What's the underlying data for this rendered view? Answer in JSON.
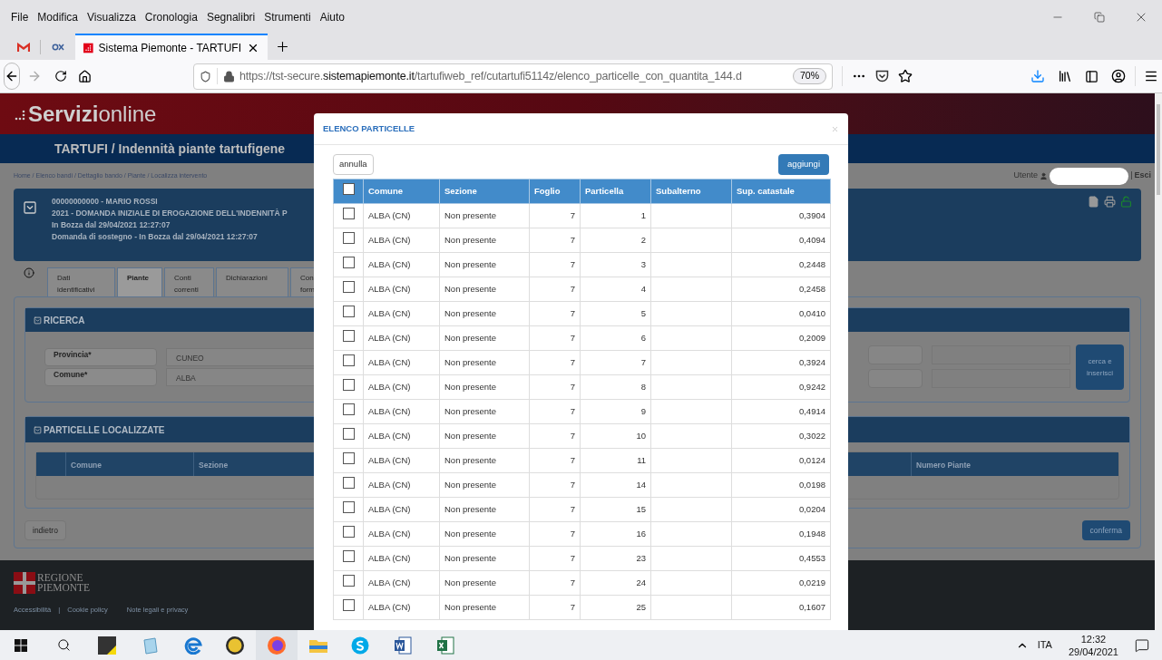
{
  "browser": {
    "menu": [
      "File",
      "Modifica",
      "Visualizza",
      "Cronologia",
      "Segnalibri",
      "Strumenti",
      "Aiuto"
    ],
    "tab": {
      "title": "Sistema Piemonte - TARTUFI",
      "selected": true
    },
    "url": {
      "prefix": "https://tst-secure.",
      "domain": "sistemapiemonte.it",
      "path": "/tartufiweb_ref/cutartufi5114z/elenco_particelle_con_quantita_144.d"
    },
    "zoom": "70%"
  },
  "page": {
    "logo": {
      "bold": "Servizi",
      "light": "online"
    },
    "title": "TARTUFI / Indennità piante tartufigene",
    "breadcrumb": "Home / Elenco bandi / Dettaglio bando / Piante / Localizza intervento",
    "user": {
      "label": "Utente",
      "separator": "|",
      "logout": "Esci"
    },
    "summary": [
      "00000000000 - MARIO ROSSI",
      "2021 - DOMANDA INIZIALE DI EROGAZIONE DELL'INDENNITÀ P",
      "In Bozza dal 29/04/2021 12:27:07",
      "Domanda di sostegno - In Bozza dal 29/04/2021 12:27:07"
    ],
    "tabs": [
      {
        "label": "Dati identificativi",
        "selected": false
      },
      {
        "label": "Piante",
        "selected": true
      },
      {
        "label": "Conti correnti",
        "selected": false
      },
      {
        "label": "Dichiarazioni",
        "selected": false
      },
      {
        "label": "Con form",
        "selected": false
      }
    ],
    "search_panel": {
      "title": "RICERCA",
      "fields": [
        {
          "label": "Provincia*",
          "value": "CUNEO"
        },
        {
          "label": "Comune*",
          "value": "ALBA"
        }
      ],
      "button": "cerca e inserisci"
    },
    "results_panel": {
      "title": "PARTICELLE LOCALIZZATE",
      "columns": [
        "Comune",
        "Sezione",
        "Numero Piante"
      ]
    },
    "back_button": "indietro",
    "confirm_button": "conferma",
    "footer": {
      "logo": [
        "REGIONE",
        "PIEMONTE"
      ],
      "links": [
        "Accessibilità",
        "Cookie policy",
        "Note legali e privacy"
      ],
      "separator": "|"
    }
  },
  "modal": {
    "title": "ELENCO PARTICELLE",
    "cancel": "annulla",
    "add": "aggiungi",
    "select_all": {
      "checked": false
    },
    "columns": [
      "Comune",
      "Sezione",
      "Foglio",
      "Particella",
      "Subalterno",
      "Sup. catastale"
    ],
    "rows": [
      {
        "comune": "ALBA (CN)",
        "sezione": "Non presente",
        "foglio": "7",
        "particella": "1",
        "superficie": "0,3904",
        "checked": false
      },
      {
        "comune": "ALBA (CN)",
        "sezione": "Non presente",
        "foglio": "7",
        "particella": "2",
        "superficie": "0,4094",
        "checked": false
      },
      {
        "comune": "ALBA (CN)",
        "sezione": "Non presente",
        "foglio": "7",
        "particella": "3",
        "superficie": "0,2448",
        "checked": false
      },
      {
        "comune": "ALBA (CN)",
        "sezione": "Non presente",
        "foglio": "7",
        "particella": "4",
        "superficie": "0,2458",
        "checked": false
      },
      {
        "comune": "ALBA (CN)",
        "sezione": "Non presente",
        "foglio": "7",
        "particella": "5",
        "superficie": "0,0410",
        "checked": false
      },
      {
        "comune": "ALBA (CN)",
        "sezione": "Non presente",
        "foglio": "7",
        "particella": "6",
        "superficie": "0,2009",
        "checked": false
      },
      {
        "comune": "ALBA (CN)",
        "sezione": "Non presente",
        "foglio": "7",
        "particella": "7",
        "superficie": "0,3924",
        "checked": false
      },
      {
        "comune": "ALBA (CN)",
        "sezione": "Non presente",
        "foglio": "7",
        "particella": "8",
        "superficie": "0,9242",
        "checked": false
      },
      {
        "comune": "ALBA (CN)",
        "sezione": "Non presente",
        "foglio": "7",
        "particella": "9",
        "superficie": "0,4914",
        "checked": false
      },
      {
        "comune": "ALBA (CN)",
        "sezione": "Non presente",
        "foglio": "7",
        "particella": "10",
        "superficie": "0,3022",
        "checked": false
      },
      {
        "comune": "ALBA (CN)",
        "sezione": "Non presente",
        "foglio": "7",
        "particella": "11",
        "superficie": "0,0124",
        "checked": false
      },
      {
        "comune": "ALBA (CN)",
        "sezione": "Non presente",
        "foglio": "7",
        "particella": "14",
        "superficie": "0,0198",
        "checked": false
      },
      {
        "comune": "ALBA (CN)",
        "sezione": "Non presente",
        "foglio": "7",
        "particella": "15",
        "superficie": "0,0204",
        "checked": false
      },
      {
        "comune": "ALBA (CN)",
        "sezione": "Non presente",
        "foglio": "7",
        "particella": "16",
        "superficie": "0,1948",
        "checked": false
      },
      {
        "comune": "ALBA (CN)",
        "sezione": "Non presente",
        "foglio": "7",
        "particella": "23",
        "superficie": "0,4553",
        "checked": false
      },
      {
        "comune": "ALBA (CN)",
        "sezione": "Non presente",
        "foglio": "7",
        "particella": "24",
        "superficie": "0,0219",
        "checked": false
      },
      {
        "comune": "ALBA (CN)",
        "sezione": "Non presente",
        "foglio": "7",
        "particella": "25",
        "superficie": "0,1607",
        "checked": false
      }
    ]
  },
  "taskbar": {
    "language": "ITA",
    "time": "12:32",
    "date": "29/04/2021"
  }
}
